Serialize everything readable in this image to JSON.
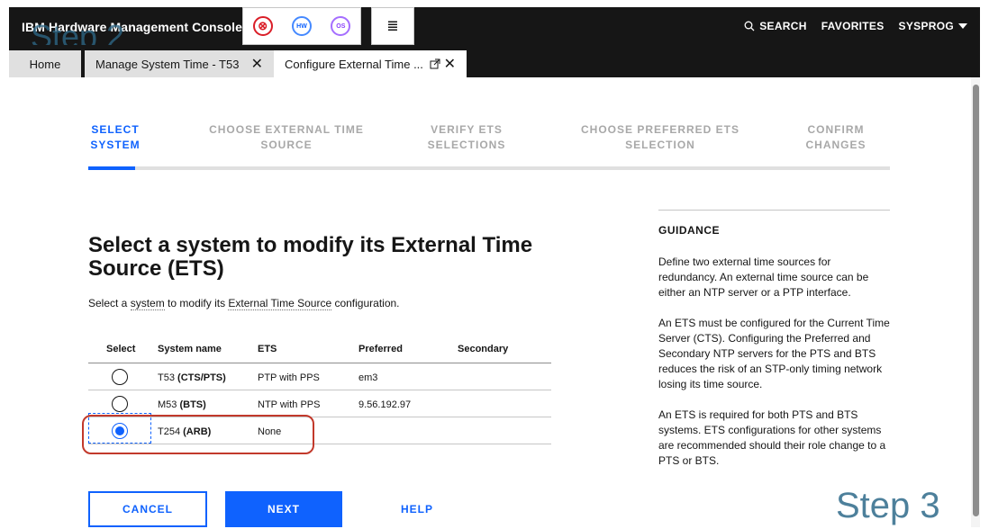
{
  "header": {
    "brand": "IBM Hardware Management Console",
    "step_overlay": "Step 2",
    "tool_icons": [
      {
        "name": "error-status-icon",
        "glyph": "⊗"
      },
      {
        "name": "hardware-status-icon",
        "glyph": "HW"
      },
      {
        "name": "os-status-icon",
        "glyph": "OS"
      },
      {
        "name": "task-list-icon",
        "glyph": "≣"
      }
    ],
    "search_label": "SEARCH",
    "favorites_label": "FAVORITES",
    "user_label": "SYSPROG"
  },
  "tabs": [
    {
      "label": "Home"
    },
    {
      "label": "Manage System Time - T53"
    },
    {
      "label": "Configure External Time ..."
    }
  ],
  "progress": {
    "steps": [
      {
        "line1": "SELECT",
        "line2": "SYSTEM"
      },
      {
        "line1": "CHOOSE EXTERNAL TIME",
        "line2": "SOURCE"
      },
      {
        "line1": "VERIFY ETS",
        "line2": "SELECTIONS"
      },
      {
        "line1": "CHOOSE PREFERRED ETS",
        "line2": "SELECTION"
      },
      {
        "line1": "CONFIRM",
        "line2": "CHANGES"
      }
    ],
    "current_step": 1
  },
  "main": {
    "heading": "Select a system to modify its External Time Source (ETS)",
    "subtitle_prefix": "Select a ",
    "subtitle_link1": "system",
    "subtitle_mid": " to modify its ",
    "subtitle_link2": "External Time Source",
    "subtitle_suffix": " configuration."
  },
  "table": {
    "headers": {
      "select": "Select",
      "name": "System name",
      "ets": "ETS",
      "preferred": "Preferred",
      "secondary": "Secondary"
    },
    "rows": [
      {
        "name": "T53",
        "role": "(CTS/PTS)",
        "ets": "PTP with PPS",
        "preferred": "em3",
        "secondary": "",
        "selected": false
      },
      {
        "name": "M53",
        "role": "(BTS)",
        "ets": "NTP with PPS",
        "preferred": "9.56.192.97",
        "secondary": "",
        "selected": false
      },
      {
        "name": "T254",
        "role": "(ARB)",
        "ets": "None",
        "preferred": "",
        "secondary": "",
        "selected": true
      }
    ]
  },
  "buttons": {
    "cancel": "CANCEL",
    "next": "NEXT",
    "help": "HELP"
  },
  "guidance": {
    "title": "GUIDANCE",
    "paragraphs": [
      "Define two external time sources for redundancy. An external time source can be either an NTP server or a PTP interface.",
      "An ETS must be configured for the Current Time Server (CTS). Configuring the Preferred and Secondary NTP servers for the PTS and BTS reduces the risk of an STP-only timing network losing its time source.",
      "An ETS is required for both PTS and BTS systems. ETS configurations for other systems are recommended should their role change to a PTS or BTS."
    ]
  },
  "step3_overlay": "Step 3",
  "colors": {
    "accent": "#0f62fe",
    "header_bg": "#161616",
    "callout": "#c2392b"
  }
}
